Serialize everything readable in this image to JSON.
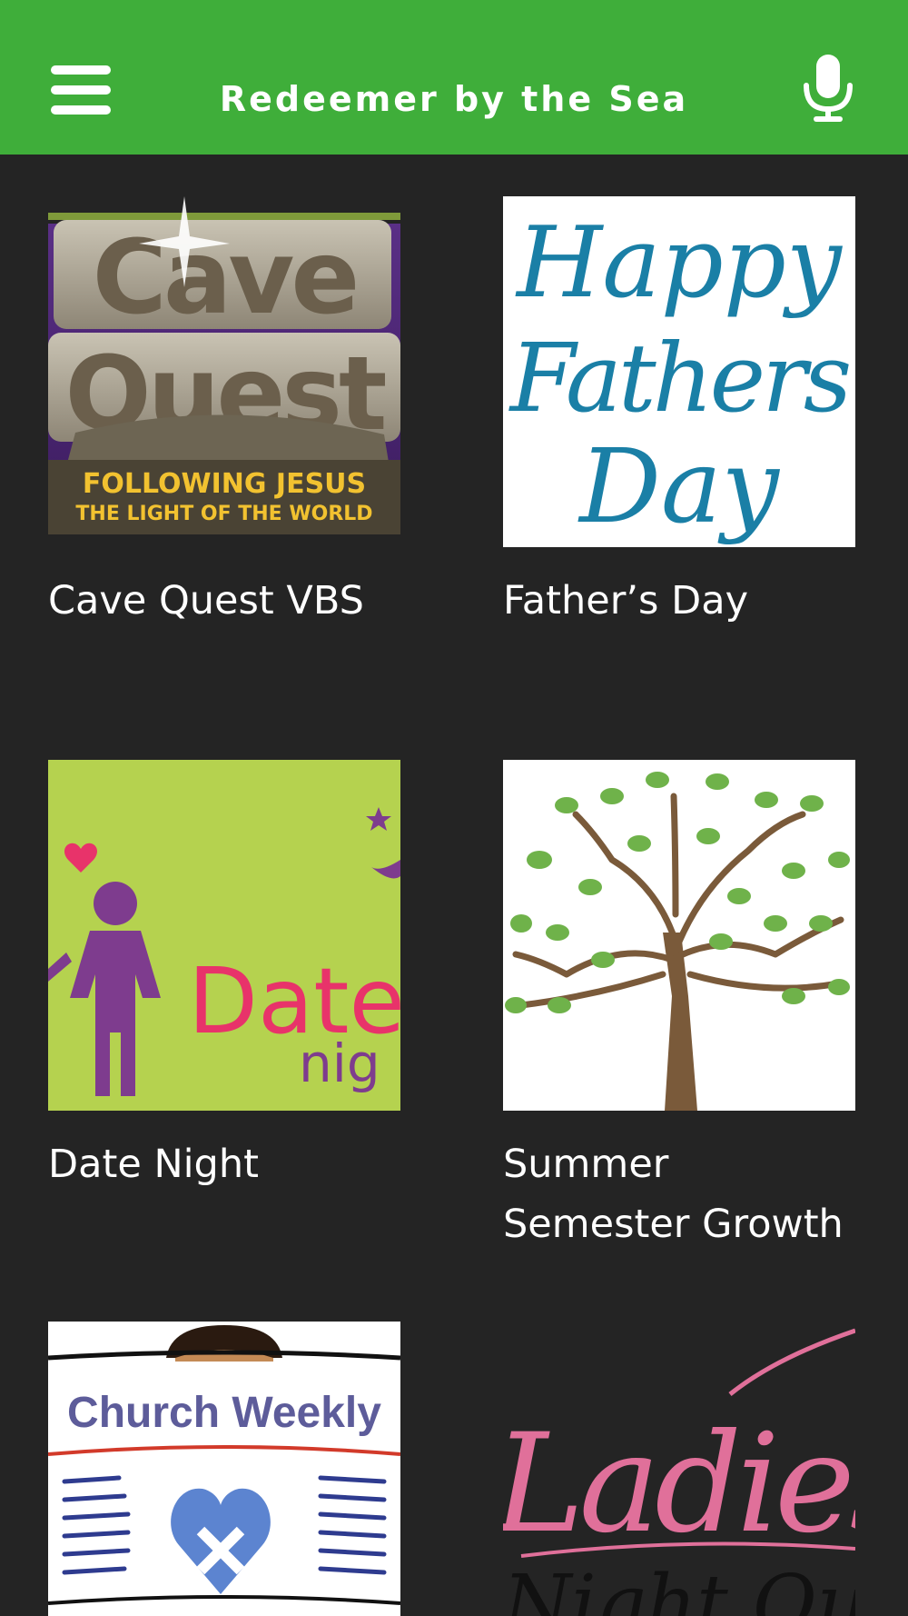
{
  "header": {
    "title": "Redeemer by the Sea",
    "menu_icon": "hamburger-menu-icon",
    "mic_icon": "microphone-icon"
  },
  "colors": {
    "header_bg": "#3fae3a",
    "page_bg": "#242424",
    "text": "#ffffff"
  },
  "items": [
    {
      "label": "Cave Quest VBS",
      "image": {
        "title_line1": "Cave",
        "title_line2": "Quest",
        "banner_line1": "FOLLOWING JESUS",
        "banner_line2": "THE LIGHT OF THE WORLD"
      }
    },
    {
      "label": "Father’s Day",
      "image": {
        "line1": "Happy",
        "line2": "Fathers",
        "line3": "Day"
      }
    },
    {
      "label": "Date Night",
      "image": {
        "line1": "Date",
        "line2": "nig"
      }
    },
    {
      "label": "Summer Semester Growth",
      "image": {}
    },
    {
      "label": "",
      "image": {
        "line1": "Church Weekly"
      }
    },
    {
      "label": "",
      "image": {
        "line1": "Ladies",
        "line2": "Night Out"
      }
    }
  ]
}
